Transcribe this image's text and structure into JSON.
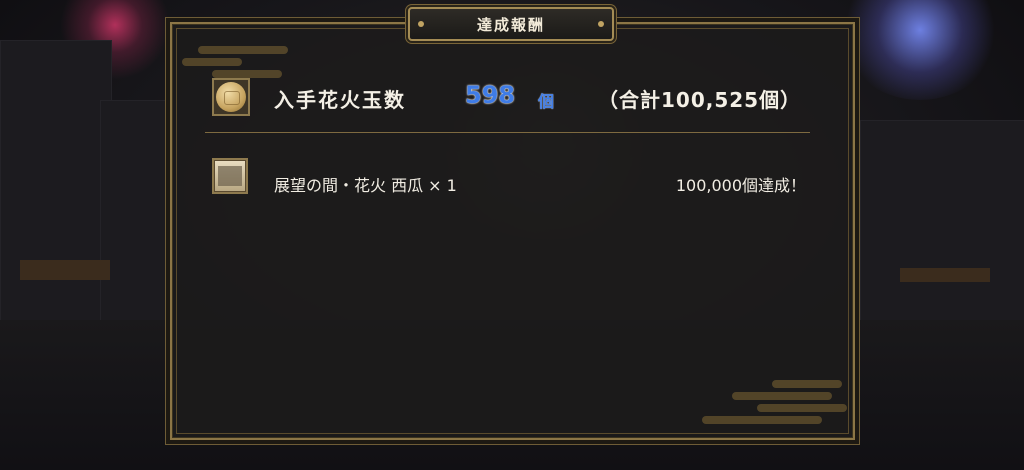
{
  "header": {
    "title": "達成報酬"
  },
  "summary": {
    "label": "入手花火玉数",
    "count": "598",
    "unit": "個",
    "total": "（合計100,525個）",
    "icon": "firework-ball-icon"
  },
  "rewards": [
    {
      "name": "展望の間・花火 西瓜 × 1",
      "condition": "100,000個達成！",
      "icon": "scroll-painting-icon"
    }
  ],
  "colors": {
    "accent_gold": "#8c7646",
    "count_blue": "#3f7ce6",
    "panel_bg": "#1c1b1b"
  }
}
